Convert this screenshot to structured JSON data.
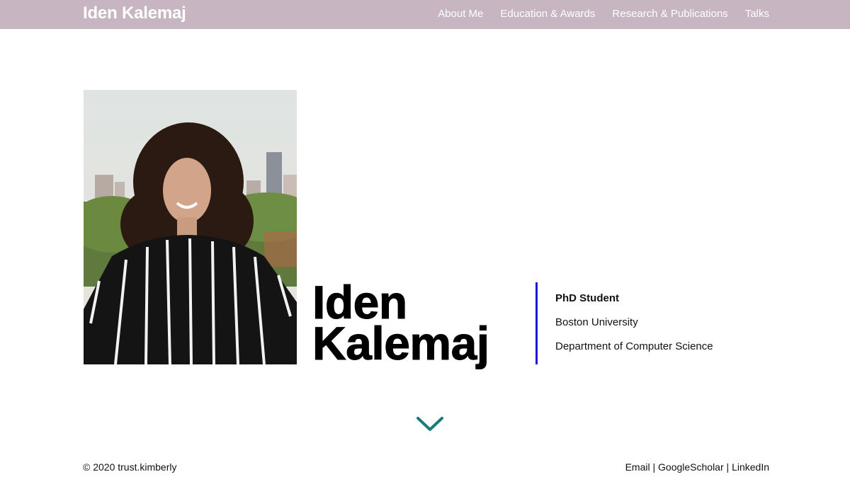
{
  "header": {
    "brand": "Iden Kalemaj",
    "nav": [
      "About Me",
      "Education & Awards",
      "Research & Publications",
      "Talks"
    ]
  },
  "hero": {
    "name_line1": "Iden",
    "name_line2": "Kalemaj",
    "role": "PhD Student",
    "university": "Boston University",
    "department": "Department of Computer Science",
    "divider_color": "#1a1ad6"
  },
  "scroll": {
    "icon": "chevron-down-icon",
    "color": "#1b7b7b"
  },
  "footer": {
    "copyright": "© 2020 trust.kimberly",
    "links": [
      "Email",
      "GoogleScholar",
      "LinkedIn"
    ],
    "separator": "|"
  },
  "colors": {
    "header_bg": "#c7b6c1",
    "header_text": "#ffffff"
  }
}
